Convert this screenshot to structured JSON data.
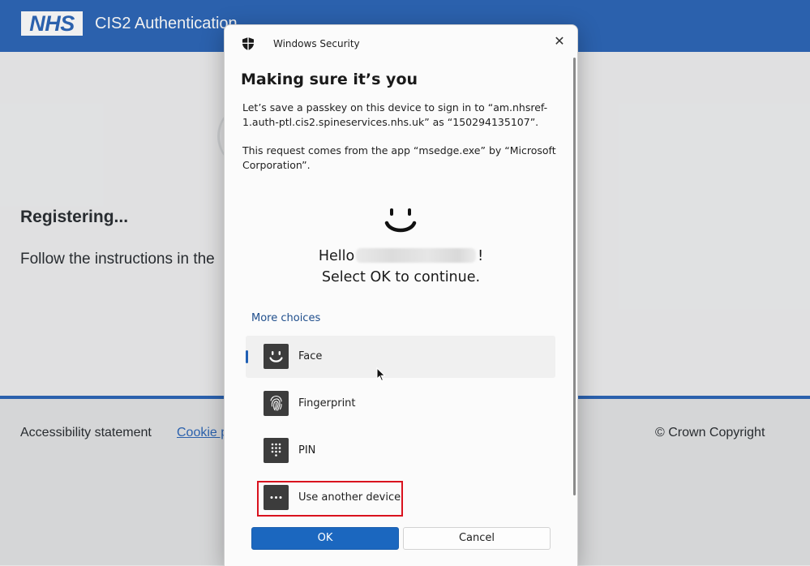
{
  "background_page": {
    "logo_text": "NHS",
    "service_name": "CIS2 Authentication",
    "status_heading": "Registering...",
    "instruction_text": "Follow the instructions in the",
    "footer": {
      "accessibility_link": "Accessibility statement",
      "cookie_link": "Cookie p",
      "copyright": "© Crown Copyright"
    },
    "colors": {
      "header_blue": "#2e68b8"
    }
  },
  "dialog": {
    "app_title": "Windows Security",
    "heading": "Making sure it’s you",
    "paragraph1": "Let’s save a passkey on this device to sign in to “am.nhsref-1.auth-ptl.cis2.spineservices.nhs.uk” as “150294135107”.",
    "paragraph2": "This request comes from the app “msedge.exe” by “Microsoft Corporation”.",
    "hello_prefix": "Hello",
    "hello_suffix": "!",
    "select_ok": "Select OK to continue.",
    "more_choices": "More choices",
    "choices": [
      {
        "label": "Face",
        "icon": "face-icon",
        "selected": true
      },
      {
        "label": "Fingerprint",
        "icon": "fingerprint-icon",
        "selected": false
      },
      {
        "label": "PIN",
        "icon": "pin-keypad-icon",
        "selected": false
      },
      {
        "label": "Use another device",
        "icon": "more-dots-icon",
        "selected": false,
        "highlighted": true
      }
    ],
    "ok_button": "OK",
    "cancel_button": "Cancel",
    "close_glyph": "✕",
    "colors": {
      "ok_blue": "#1b67bf",
      "highlight_red": "#d9121e",
      "link_blue": "#1f4e8c"
    }
  }
}
